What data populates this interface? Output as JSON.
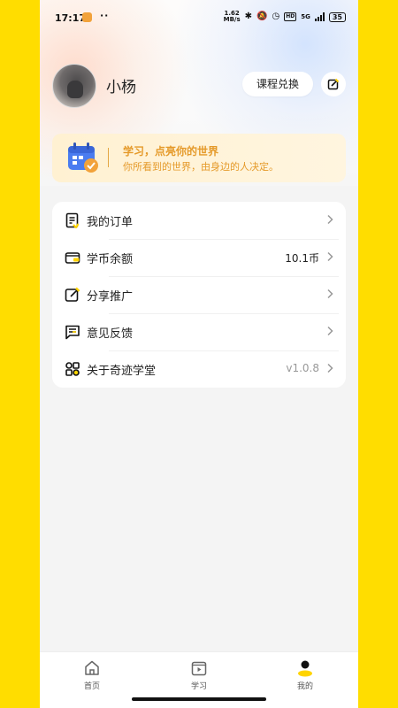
{
  "status_bar": {
    "time": "17:17",
    "dots": "··",
    "net_speed_value": "1.62",
    "net_speed_unit": "MB/s",
    "hd": "HD",
    "network": "5G",
    "battery": "35"
  },
  "profile": {
    "name": "小杨",
    "redeem_label": "课程兑换",
    "edit_icon": "edit-icon"
  },
  "banner": {
    "title": "学习，点亮你的世界",
    "subtitle": "你所看到的世界，由身边的人决定。",
    "icon": "calendar-check-icon",
    "accent_color": "#E59A2A"
  },
  "menu": {
    "items": [
      {
        "label": "我的订单",
        "value": "",
        "icon": "order-icon"
      },
      {
        "label": "学币余额",
        "value": "10.1币",
        "icon": "wallet-icon"
      },
      {
        "label": "分享推广",
        "value": "",
        "icon": "share-edit-icon"
      },
      {
        "label": "意见反馈",
        "value": "",
        "icon": "feedback-icon"
      },
      {
        "label": "关于奇迹学堂",
        "value": "v1.0.8",
        "icon": "about-icon"
      }
    ]
  },
  "tab_bar": {
    "tabs": [
      {
        "label": "首页",
        "icon": "home-icon"
      },
      {
        "label": "学习",
        "icon": "play-folder-icon"
      },
      {
        "label": "我的",
        "icon": "profile-icon",
        "active": true
      }
    ]
  },
  "colors": {
    "background": "#FFDD00",
    "accent": "#FFD400"
  }
}
